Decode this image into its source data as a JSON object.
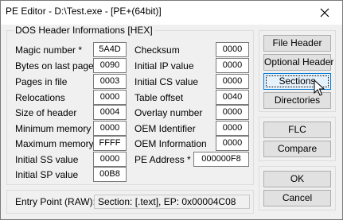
{
  "window": {
    "title": "PE Editor - D:\\Test.exe - [PE+(64bit)]"
  },
  "dos_header": {
    "group_title": "DOS Header Informations [HEX]",
    "left": [
      {
        "label": "Magic number *",
        "value": "5A4D"
      },
      {
        "label": "Bytes on last page",
        "value": "0090"
      },
      {
        "label": "Pages in file",
        "value": "0003"
      },
      {
        "label": "Relocations",
        "value": "0000"
      },
      {
        "label": "Size of header",
        "value": "0004"
      },
      {
        "label": "Minimum memory",
        "value": "0000"
      },
      {
        "label": "Maximum memory",
        "value": "FFFF"
      },
      {
        "label": "Initial SS value",
        "value": "0000"
      },
      {
        "label": "Initial SP value",
        "value": "00B8"
      }
    ],
    "right": [
      {
        "label": "Checksum",
        "value": "0000"
      },
      {
        "label": "Initial IP value",
        "value": "0000"
      },
      {
        "label": "Initial CS value",
        "value": "0000"
      },
      {
        "label": "Table offset",
        "value": "0040"
      },
      {
        "label": "Overlay number",
        "value": "0000"
      },
      {
        "label": "OEM Identifier",
        "value": "0000"
      },
      {
        "label": "OEM Information",
        "value": "0000"
      }
    ],
    "pe_address": {
      "label": "PE Address *",
      "value": "000000F8"
    }
  },
  "buttons": {
    "file_header": "File Header",
    "optional_header": "Optional Header",
    "sections": "Sections",
    "directories": "Directories",
    "flc": "FLC",
    "compare": "Compare",
    "ok": "OK",
    "cancel": "Cancel"
  },
  "entry_point": {
    "label": "Entry Point (RAW):",
    "value": "Section: [.text], EP: 0x00004C08"
  }
}
